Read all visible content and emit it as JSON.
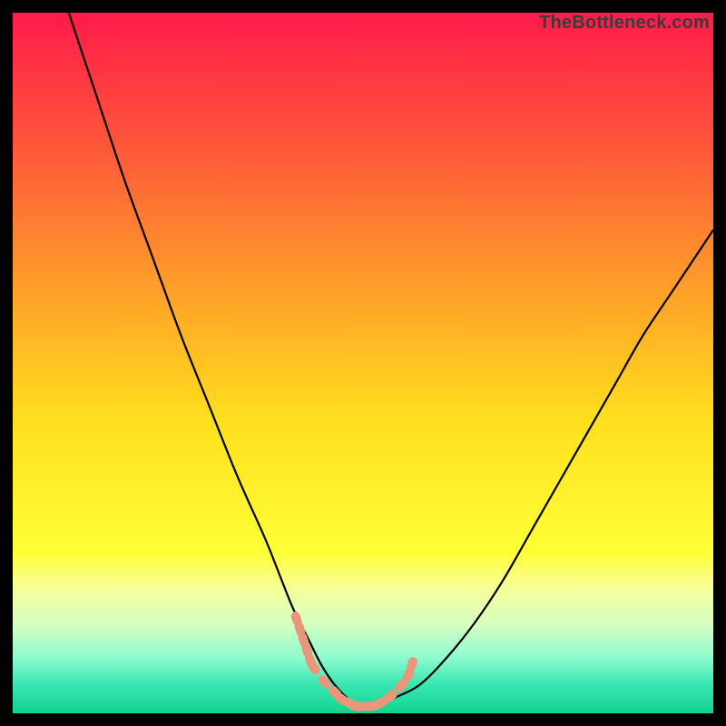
{
  "watermark": "TheBottleneck.com",
  "chart_data": {
    "type": "line",
    "title": "",
    "xlabel": "",
    "ylabel": "",
    "xlim": [
      0,
      100
    ],
    "ylim": [
      0,
      100
    ],
    "grid": false,
    "legend": false,
    "gradient_stops": [
      {
        "offset": 0.0,
        "color": "#ff1b4a"
      },
      {
        "offset": 0.18,
        "color": "#ff533b"
      },
      {
        "offset": 0.38,
        "color": "#ff9a2a"
      },
      {
        "offset": 0.58,
        "color": "#ffdf1d"
      },
      {
        "offset": 0.77,
        "color": "#ffff36"
      },
      {
        "offset": 0.82,
        "color": "#f7ff96"
      },
      {
        "offset": 0.87,
        "color": "#d9ffc0"
      },
      {
        "offset": 0.92,
        "color": "#90fbd0"
      },
      {
        "offset": 0.96,
        "color": "#36e6b2"
      },
      {
        "offset": 1.0,
        "color": "#13d38e"
      }
    ],
    "series": [
      {
        "name": "bottleneck-curve",
        "color": "#000000",
        "x": [
          8,
          12,
          16,
          20,
          24,
          28,
          32,
          36,
          38,
          40,
          42,
          44,
          46,
          48,
          50,
          52,
          54,
          58,
          62,
          66,
          70,
          74,
          78,
          82,
          86,
          90,
          94,
          98,
          100
        ],
        "y": [
          100,
          88,
          76,
          65,
          54,
          44,
          34,
          25,
          20,
          15,
          11,
          7,
          4,
          2,
          1,
          1,
          2,
          4,
          8,
          13,
          19,
          26,
          33,
          40,
          47,
          54,
          60,
          66,
          69
        ]
      }
    ],
    "tick_markers": {
      "name": "range-ticks",
      "color": "#e9967a",
      "points": [
        {
          "x": 40.5,
          "y": 13.5
        },
        {
          "x": 41.0,
          "y": 12.0
        },
        {
          "x": 41.5,
          "y": 10.5
        },
        {
          "x": 42.0,
          "y": 9.0
        },
        {
          "x": 42.5,
          "y": 7.5
        },
        {
          "x": 43.0,
          "y": 6.5
        },
        {
          "x": 44.5,
          "y": 4.5
        },
        {
          "x": 46.0,
          "y": 3.0
        },
        {
          "x": 47.0,
          "y": 2.0
        },
        {
          "x": 48.0,
          "y": 1.5
        },
        {
          "x": 49.0,
          "y": 1.0
        },
        {
          "x": 50.0,
          "y": 1.0
        },
        {
          "x": 51.0,
          "y": 1.0
        },
        {
          "x": 52.0,
          "y": 1.2
        },
        {
          "x": 53.0,
          "y": 1.8
        },
        {
          "x": 54.0,
          "y": 2.5
        },
        {
          "x": 55.5,
          "y": 4.0
        },
        {
          "x": 56.5,
          "y": 5.5
        },
        {
          "x": 57.0,
          "y": 7.0
        }
      ]
    }
  }
}
